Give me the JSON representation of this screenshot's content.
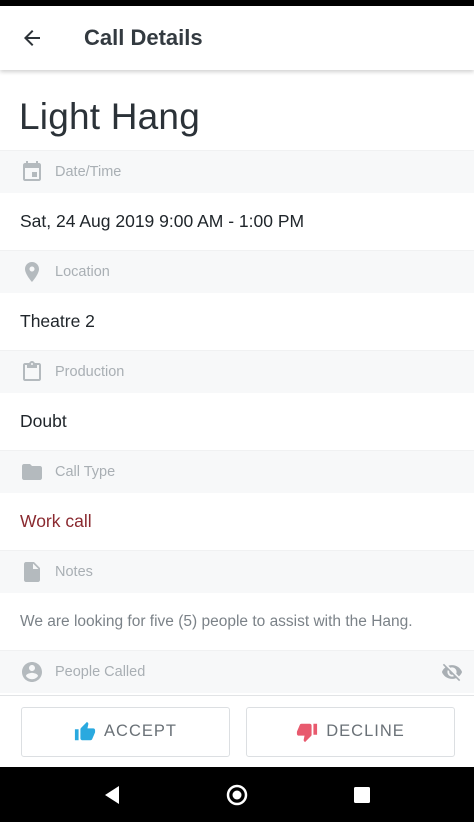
{
  "app_bar": {
    "title": "Call Details"
  },
  "call": {
    "name": "Light Hang"
  },
  "sections": {
    "datetime": {
      "label": "Date/Time",
      "value": "Sat, 24 Aug 2019 9:00 AM - 1:00 PM"
    },
    "location": {
      "label": "Location",
      "value": "Theatre 2"
    },
    "production": {
      "label": "Production",
      "value": "Doubt"
    },
    "call_type": {
      "label": "Call Type",
      "value": "Work call"
    },
    "notes": {
      "label": "Notes",
      "value": "We are looking for five (5) people to assist with the Hang."
    },
    "people": {
      "label": "People Called"
    }
  },
  "actions": {
    "accept": "ACCEPT",
    "decline": "DECLINE"
  },
  "colors": {
    "accept_icon": "#2aa9df",
    "decline_icon": "#e85a6e",
    "work_call": "#8a2a30"
  }
}
